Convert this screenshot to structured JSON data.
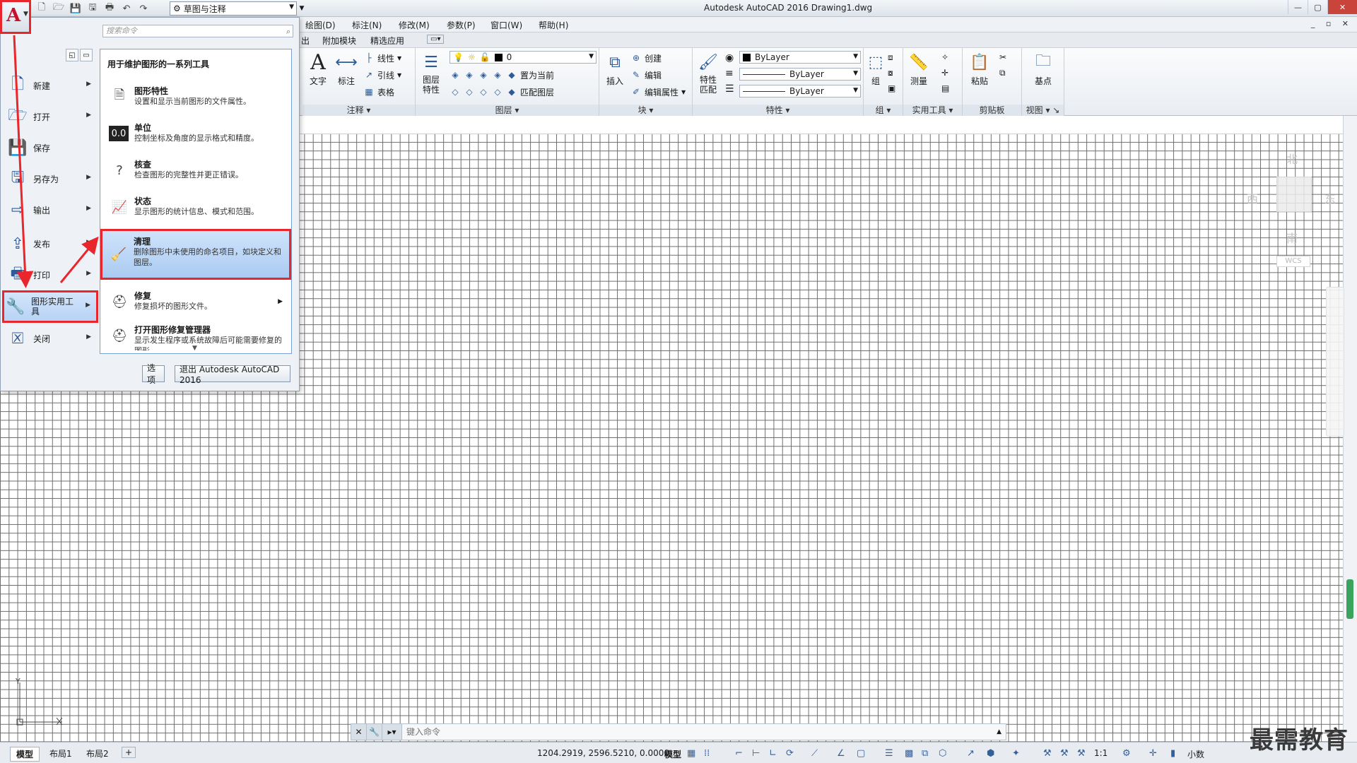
{
  "window": {
    "title": "Autodesk AutoCAD 2016    Drawing1.dwg",
    "controls": [
      "—",
      "▢",
      "✕"
    ]
  },
  "quick_access": {
    "workspace": "草图与注释",
    "icons": [
      "new-icon",
      "open-icon",
      "save-icon",
      "save-as-icon",
      "print-icon",
      "undo-icon",
      "redo-icon"
    ]
  },
  "menubar": {
    "items": [
      "绘图(D)",
      "标注(N)",
      "修改(M)",
      "参数(P)",
      "窗口(W)",
      "帮助(H)"
    ],
    "doc_controls": "_ ▫ ✕"
  },
  "ribbon_tabs": [
    "出",
    "附加模块",
    "精选应用"
  ],
  "ribbon": {
    "annotation": {
      "title": "注释",
      "text": "文字",
      "dim": "标注",
      "linear": "线性",
      "leader": "引线",
      "table": "表格"
    },
    "layers": {
      "title": "图层",
      "props": "图层\n特性",
      "layer_value": "0",
      "set_current": "置为当前",
      "match_layer": "匹配图层"
    },
    "block": {
      "title": "块",
      "insert": "插入",
      "create": "创建",
      "edit": "编辑",
      "edit_attr": "编辑属性"
    },
    "properties": {
      "title": "特性",
      "match": "特性\n匹配",
      "color": "ByLayer",
      "linetype": "ByLayer",
      "lineweight": "ByLayer"
    },
    "groups": {
      "title": "组",
      "group": "组"
    },
    "utilities": {
      "title": "实用工具",
      "measure": "测量"
    },
    "clipboard": {
      "title": "剪贴板",
      "paste": "粘贴"
    },
    "view": {
      "title": "视图",
      "base": "基点"
    }
  },
  "app_menu": {
    "search_placeholder": "搜索命令",
    "left_items": [
      {
        "label": "新建"
      },
      {
        "label": "打开"
      },
      {
        "label": "保存"
      },
      {
        "label": "另存为"
      },
      {
        "label": "输出"
      },
      {
        "label": "发布"
      },
      {
        "label": "打印"
      },
      {
        "label": "图形实用工具"
      },
      {
        "label": "关闭"
      }
    ],
    "submenu": {
      "title": "用于维护图形的一系列工具",
      "items": [
        {
          "title": "图形特性",
          "desc": "设置和显示当前图形的文件属性。"
        },
        {
          "title": "单位",
          "desc": "控制坐标及角度的显示格式和精度。"
        },
        {
          "title": "核查",
          "desc": "检查图形的完整性并更正错误。"
        },
        {
          "title": "状态",
          "desc": "显示图形的统计信息、模式和范围。"
        },
        {
          "title": "清理",
          "desc": "删除图形中未使用的命名项目，如块定义和图层。"
        },
        {
          "title": "修复",
          "desc": "修复损坏的图形文件。"
        },
        {
          "title": "打开图形修复管理器",
          "desc": "显示发生程序或系统故障后可能需要修复的图形。"
        }
      ]
    },
    "options_button": "选项",
    "exit_button": "退出 Autodesk AutoCAD 2016"
  },
  "viewcube": {
    "north": "北",
    "south": "南",
    "east": "东",
    "west": "西",
    "wcs": "WCS"
  },
  "ucs": {
    "y": "Y"
  },
  "command_line": {
    "placeholder": "键入命令"
  },
  "status": {
    "tabs": [
      "模型",
      "布局1",
      "布局2"
    ],
    "add_tab": "+",
    "coords": "1204.2919, 2596.5210, 0.0000",
    "model": "模型",
    "scale": "1:1",
    "units": "小数"
  },
  "watermark": "最需教育"
}
